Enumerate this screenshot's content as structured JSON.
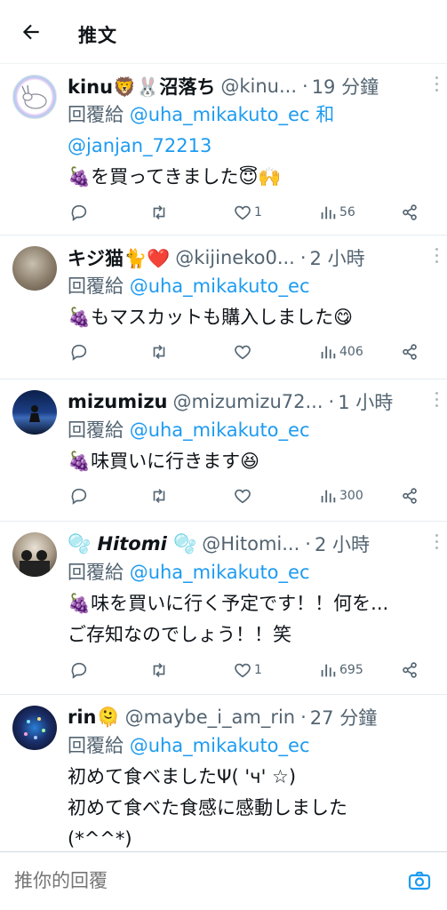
{
  "header": {
    "title": "推文"
  },
  "tweets": [
    {
      "name": "kinu🦁🐰沼落ち",
      "handle": "@kinu...",
      "time": "19 分鐘",
      "reply_prefix": "回覆給",
      "mention1": "@uha_mikakuto_ec",
      "joiner": "和",
      "mention2": "@janjan_72213",
      "text_lines": [
        "🍇を買ってきました😇🙌"
      ],
      "likes": "1",
      "views": "56"
    },
    {
      "name": "キジ猫🐈❤️",
      "handle": "@kijineko0...",
      "time": "2 小時",
      "reply_prefix": "回覆給",
      "mention1": "@uha_mikakuto_ec",
      "text_lines": [
        "🍇もマスカットも購入しました😋"
      ],
      "likes": "",
      "views": "406"
    },
    {
      "name": "mizumizu",
      "handle": "@mizumizu72...",
      "time": "1 小時",
      "reply_prefix": "回覆給",
      "mention1": "@uha_mikakuto_ec",
      "text_lines": [
        "🍇味買いに行きます😆"
      ],
      "likes": "",
      "views": "300"
    },
    {
      "name": "🫧 𝙃𝙞𝙩𝙤𝙢𝙞 🫧",
      "handle": "@Hitomi...",
      "time": "2 小時",
      "reply_prefix": "回覆給",
      "mention1": "@uha_mikakuto_ec",
      "text_lines": [
        "🍇味を買いに行く予定です！！何を...",
        "ご存知なのでしょう！！笑"
      ],
      "likes": "1",
      "views": "695"
    },
    {
      "name": "rin🫠",
      "handle": "@maybe_i_am_rin",
      "time": "27 分鐘",
      "reply_prefix": "回覆給",
      "mention1": "@uha_mikakuto_ec",
      "text_lines": [
        "初めて食べましたΨ( 'ч' ☆)",
        "初めて食べた食感に感動しました",
        "(*^^*)"
      ],
      "likes": "",
      "views": ""
    }
  ],
  "reply_bar": {
    "placeholder": "推你的回覆"
  },
  "colors": {
    "link": "#1d9bf0",
    "secondary": "#536471"
  },
  "icons": [
    "back-arrow-icon",
    "more-icon",
    "reply-icon",
    "retweet-icon",
    "like-icon",
    "views-icon",
    "share-icon",
    "camera-icon"
  ]
}
